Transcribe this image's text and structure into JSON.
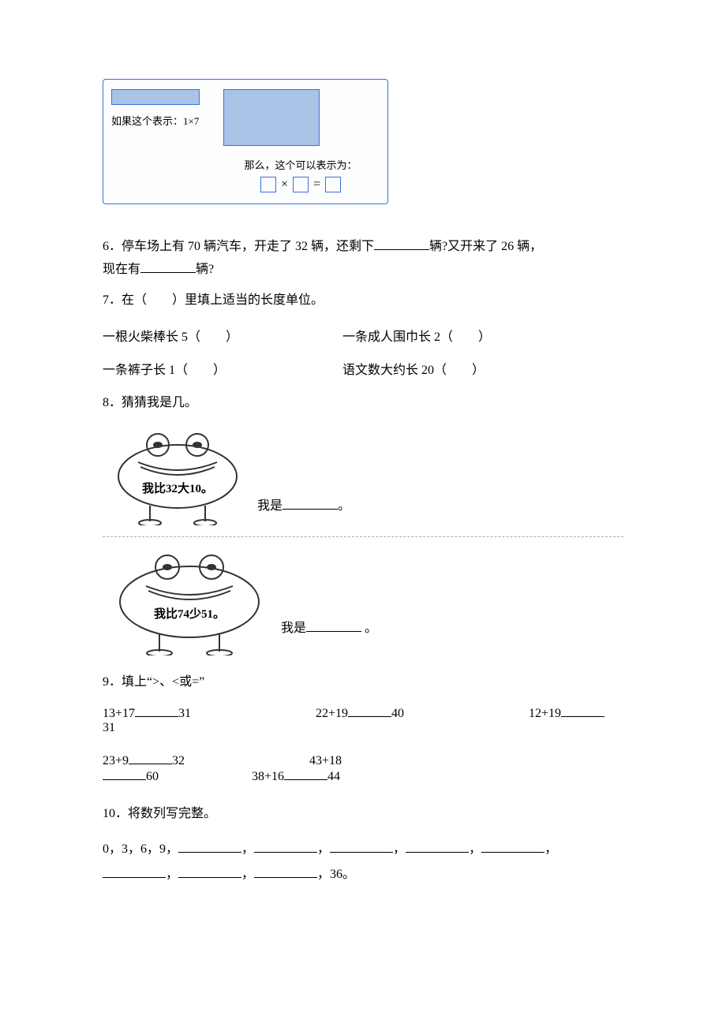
{
  "q5": {
    "label_if": "如果这个表示：1×7",
    "label_then": "那么，这个可以表示为：",
    "times": "×",
    "equals": "="
  },
  "q6": {
    "text_a": "6．停车场上有 70 辆汽车，开走了 32 辆，还剩下",
    "text_b": "辆?又开来了 26 辆，",
    "text_c": "现在有",
    "text_d": "辆?"
  },
  "q7": {
    "prompt": "7．在（　　）里填上适当的长度单位。",
    "a": "一根火柴棒长 5（　　）",
    "b": "一条成人围巾长 2（　　）",
    "c": "一条裤子长 1（　　）",
    "d": "语文数大约长 20（　　）"
  },
  "q8": {
    "title": "8．猜猜我是几。",
    "frog1_text": "我比32大10。",
    "frog2_text": "我比74少51。",
    "answer_prefix": "我是",
    "answer_suffix": "。"
  },
  "q9": {
    "title": "9．填上“>、<或=”",
    "e1a": "13+17",
    "e1b": "31",
    "e2a": "22+19",
    "e2b": "40",
    "e3a": "12+19",
    "e3b": "31",
    "e4a": "23+9",
    "e4b": "32",
    "e5a": "43+18",
    "e5b": "60",
    "e6a": "38+16",
    "e6b": "44"
  },
  "q10": {
    "title": "10．将数列写完整。",
    "seq_start": "0，3，6，9，",
    "comma": "，",
    "seq_end": "，36。"
  }
}
